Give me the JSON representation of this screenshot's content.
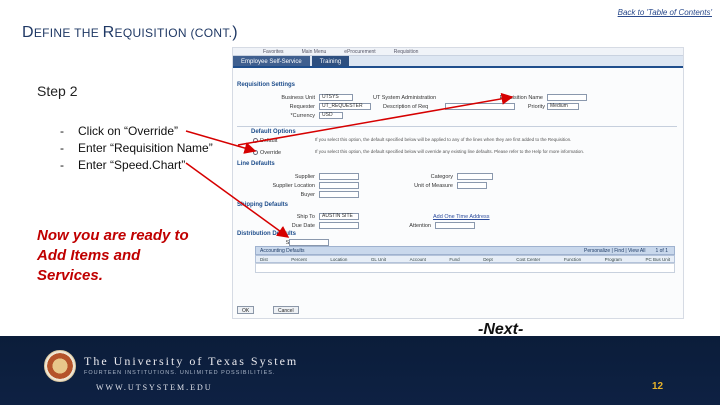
{
  "back_link": "Back to 'Table of Contents'",
  "title": {
    "part1_big": "D",
    "part1_small": "EFINE THE ",
    "part2_big": "R",
    "part2_small": "EQUISITION (",
    "part3_small": "CONT.",
    "part4_big": ")"
  },
  "step": "Step 2",
  "bullets": [
    {
      "dash": "-",
      "text": "Click on “Override”"
    },
    {
      "dash": "-",
      "text": "Enter “Requisition Name”"
    },
    {
      "dash": "-",
      "text": "Enter “Speed.Chart”"
    }
  ],
  "ready_text": "Now you are ready to Add Items and Services.",
  "next_text": "-Next-",
  "screenshot": {
    "menu": [
      "Favorites",
      "Main Menu",
      "eProcurement",
      "Requisition"
    ],
    "tabs": [
      "Employee Self-Service",
      "Training"
    ],
    "requisition_settings": "Requisition Settings",
    "business_unit_label": "Business Unit",
    "business_unit_value": "UTSYS",
    "ut_system_admin": "UT System Administration",
    "requisition_name_label": "Requisition Name",
    "requester_label": "Requester",
    "requester_value": "UT_REQUESTER",
    "description_label": "Description of Req",
    "priority_label": "Priority",
    "priority_value": "Medium",
    "currency_label": "*Currency",
    "currency_value": "USD",
    "default_options": "Default Options",
    "default_label": "Default",
    "override_label": "Override",
    "default_hint": "If you select this option, the default specified below will be applied to any of the lines when they are first added to the Requisition.",
    "override_hint": "If you select this option, the default specified below will override any existing line defaults. Please refer to the Help for more information.",
    "line_defaults": "Line Defaults",
    "supplier_label": "Supplier",
    "category_label": "Category",
    "supplier_location_label": "Supplier Location",
    "uom_label": "Unit of Measure",
    "buyer_label": "Buyer",
    "shipping_defaults": "Shipping Defaults",
    "ship_to_label": "Ship To",
    "ship_to_value": "AUSTIN SITE",
    "add_one_time": "Add One Time Address",
    "due_date_label": "Due Date",
    "attention_label": "Attention",
    "distribution_defaults": "Distribution Defaults",
    "speedchart_label": "SpeedChart",
    "speedchart_value": "",
    "grid_title": "Accounting Defaults",
    "grid_info": "Personalize | Find | View All",
    "grid_pages": "1 of 1",
    "grid_columns": [
      "Dist",
      "Percent",
      "Location",
      "GL Unit",
      "Account",
      "Fund",
      "Dept",
      "Cost Center",
      "Function",
      "Program",
      "PC Bus Unit"
    ],
    "ok_button": "OK",
    "cancel_button": "Cancel"
  },
  "footer": {
    "university": "The University of Texas System",
    "tagline": "FOURTEEN INSTITUTIONS. UNLIMITED POSSIBILITIES.",
    "url": "WWW.UTSYSTEM.EDU",
    "page_number": "12"
  },
  "colors": {
    "title": "#1f3864",
    "ready": "#c00000",
    "arrow": "#d60000",
    "footer_bg": "#0e2143",
    "page_number": "#e8b32a"
  }
}
